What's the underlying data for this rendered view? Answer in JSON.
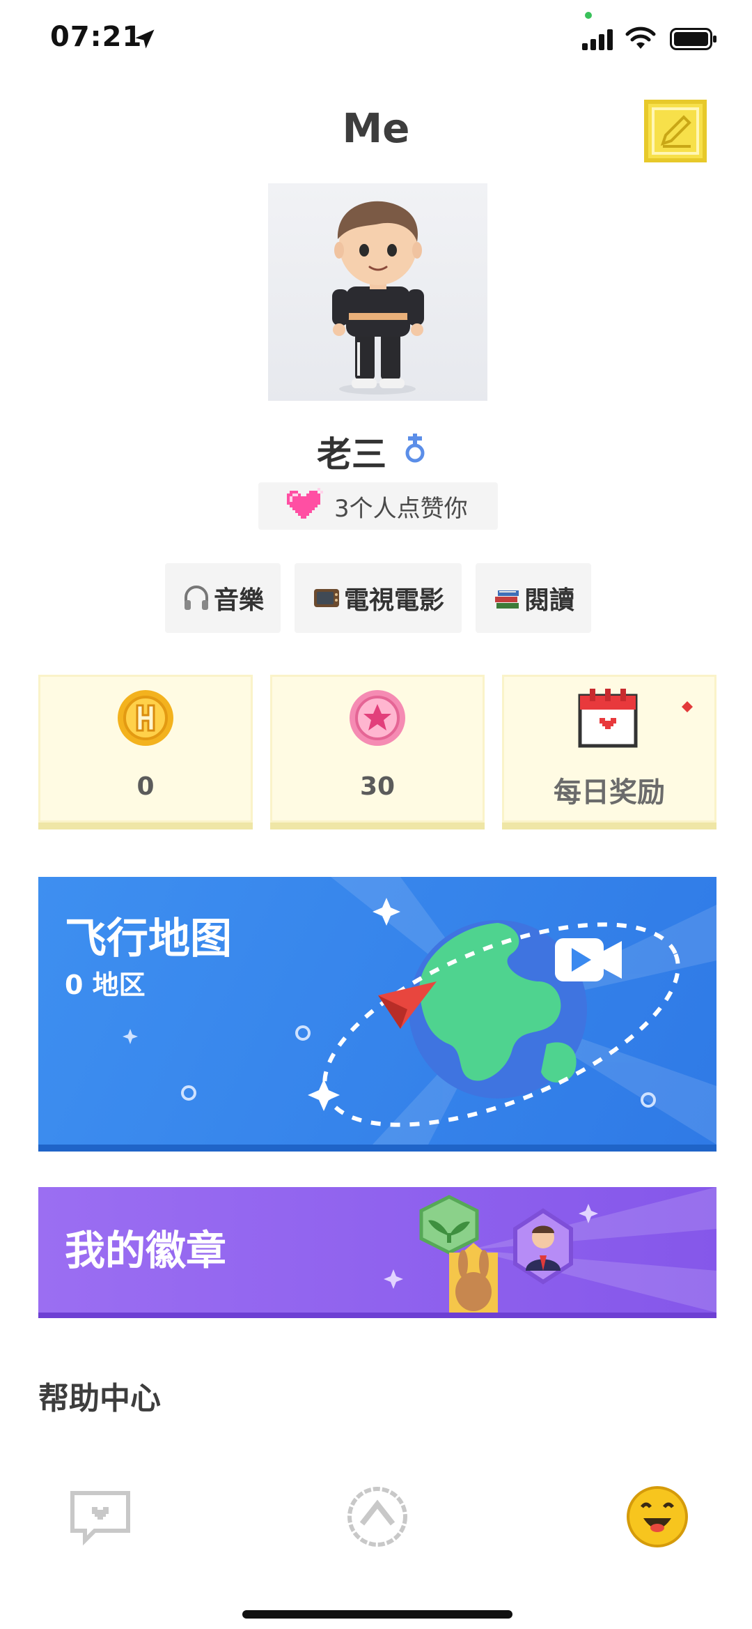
{
  "status_bar": {
    "time": "07:21"
  },
  "header": {
    "title": "Me"
  },
  "profile": {
    "name": "老三",
    "likes_text": "3个人点赞你",
    "interests": [
      {
        "label": "音樂",
        "icon": "headphones-icon"
      },
      {
        "label": "電視電影",
        "icon": "tv-icon"
      },
      {
        "label": "閱讀",
        "icon": "books-icon"
      }
    ]
  },
  "stats": {
    "coins": {
      "value": "0",
      "icon": "h-coin-icon"
    },
    "stars": {
      "value": "30",
      "icon": "star-coin-icon"
    },
    "daily_reward": {
      "label": "每日奖励",
      "icon": "calendar-heart-icon"
    }
  },
  "flight_map": {
    "title": "飞行地图",
    "subtitle": "0 地区"
  },
  "badges": {
    "title": "我的徽章"
  },
  "help": {
    "title": "帮助中心"
  },
  "tabs": [
    "chat-heart-icon",
    "compass-arrow-icon",
    "smiley-face-icon"
  ],
  "colors": {
    "accent_yellow": "#f7e04a",
    "map_blue": "#3a89ef",
    "badge_purple": "#9166ee"
  }
}
